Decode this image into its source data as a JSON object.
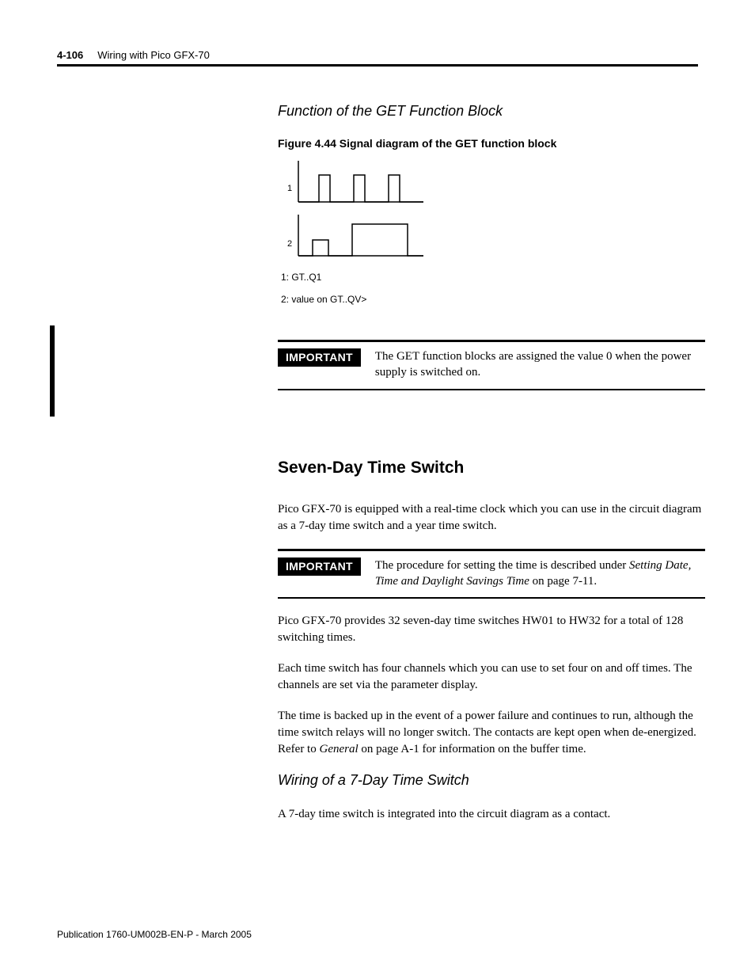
{
  "header": {
    "page_number": "4-106",
    "chapter_title": "Wiring with Pico GFX-70"
  },
  "section1": {
    "heading": "Function of the GET Function Block",
    "figure_caption": "Figure 4.44 Signal diagram of the GET function block",
    "trace_labels": {
      "t1": "1",
      "t2": "2"
    },
    "legend1": "1: GT..Q1",
    "legend2": "2: value on GT..QV>"
  },
  "important1": {
    "tag": "IMPORTANT",
    "text": "The GET function blocks are assigned the value 0 when the power supply is switched on."
  },
  "section2": {
    "heading": "Seven-Day Time Switch",
    "p1": "Pico GFX-70 is equipped with a real-time clock which you can use in the circuit diagram as a 7-day time switch and a year time switch."
  },
  "important2": {
    "tag": "IMPORTANT",
    "lead": "The procedure for setting the time is described under ",
    "ital": "Setting Date, Time and Daylight Savings Time",
    "tail": " on page 7-11."
  },
  "para": {
    "p2": "Pico GFX-70 provides 32 seven-day time switches HW01 to HW32 for a total of 128 switching times.",
    "p3": "Each time switch has four channels which you can use to set four on and off times. The channels are set via the parameter display.",
    "p4a": "The time is backed up in the event of a power failure and continues to run, although the time switch relays will no longer switch. The contacts are kept open when de-energized. Refer to ",
    "p4i": "General",
    "p4b": " on page A-1 for information on the buffer time."
  },
  "section3": {
    "heading": "Wiring of a 7-Day Time Switch",
    "p1": "A 7-day time switch is integrated into the circuit diagram as a contact."
  },
  "footer": {
    "text": "Publication 1760-UM002B-EN-P - March 2005"
  }
}
